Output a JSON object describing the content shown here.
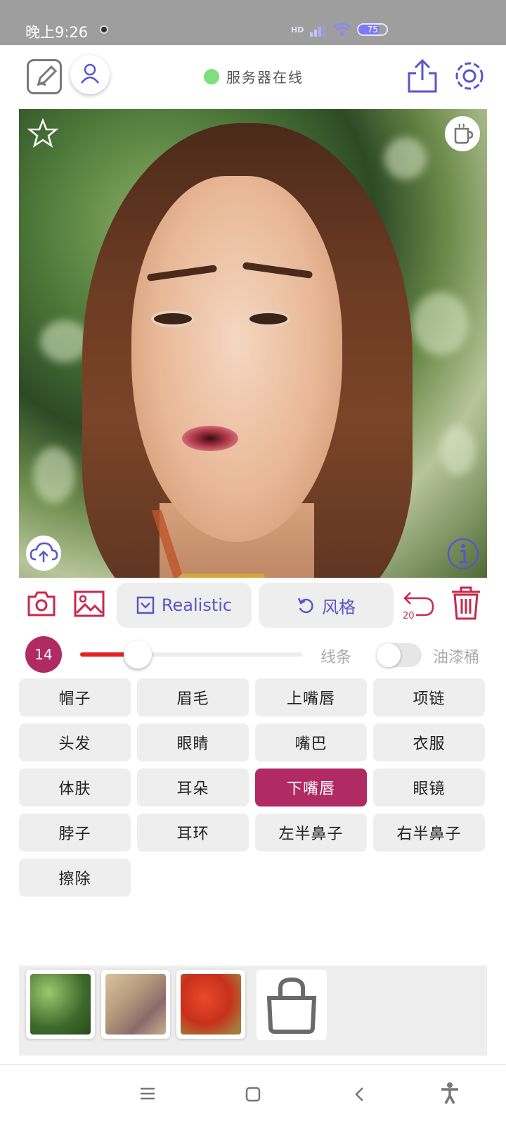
{
  "status_bar": {
    "time": "晚上9:26",
    "network_badge": "HD",
    "battery": "75",
    "battery_level_percent": 75
  },
  "header": {
    "server_status": "服务器在线",
    "status_color": "#7ce07c"
  },
  "toolbar": {
    "realistic_label": "Realistic",
    "style_label": "风格",
    "undo_count": "20"
  },
  "brush": {
    "size": "14",
    "slider_fraction": 0.26,
    "mode_line_label": "线条",
    "mode_bucket_label": "油漆桶",
    "bucket_enabled": false
  },
  "face_parts": [
    {
      "label": "帽子",
      "selected": false
    },
    {
      "label": "眉毛",
      "selected": false
    },
    {
      "label": "上嘴唇",
      "selected": false
    },
    {
      "label": "项链",
      "selected": false
    },
    {
      "label": "头发",
      "selected": false
    },
    {
      "label": "眼睛",
      "selected": false
    },
    {
      "label": "嘴巴",
      "selected": false
    },
    {
      "label": "衣服",
      "selected": false
    },
    {
      "label": "体肤",
      "selected": false
    },
    {
      "label": "耳朵",
      "selected": false
    },
    {
      "label": "下嘴唇",
      "selected": true
    },
    {
      "label": "眼镜",
      "selected": false
    },
    {
      "label": "脖子",
      "selected": false
    },
    {
      "label": "耳环",
      "selected": false
    },
    {
      "label": "左半鼻子",
      "selected": false
    },
    {
      "label": "右半鼻子",
      "selected": false
    },
    {
      "label": "擦除",
      "selected": false
    }
  ],
  "colors": {
    "accent": "#b02a63",
    "primary_icon": "#5a55c8",
    "danger_icon": "#c8284b",
    "slider_fill": "#e52222"
  },
  "icons": {
    "edit": "edit-square-icon",
    "user": "user-icon",
    "share": "share-icon",
    "settings": "gear-icon",
    "favorite": "star-icon",
    "coffee": "coffee-icon",
    "upload": "cloud-upload-icon",
    "info": "info-icon",
    "camera": "camera-icon",
    "gallery": "image-icon",
    "undo": "undo-icon",
    "delete": "trash-icon",
    "shop": "shopping-bag-icon"
  }
}
